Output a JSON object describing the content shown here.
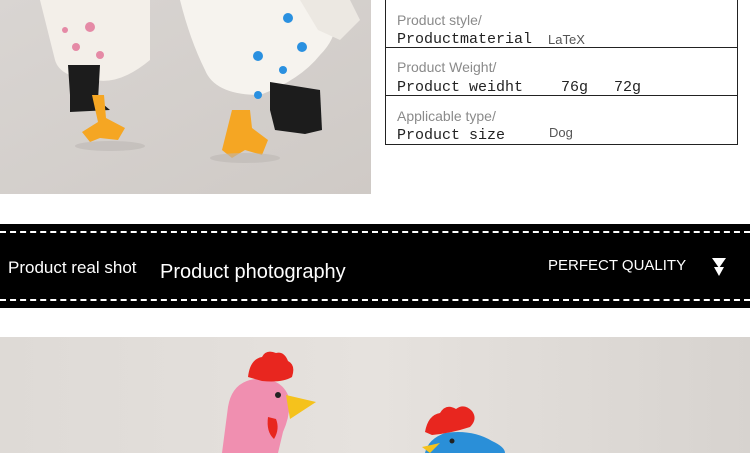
{
  "spec_table": {
    "rows": [
      {
        "label_en": "Product style/",
        "label_cn": "Productmaterial",
        "value": "LaTeX"
      },
      {
        "label_en": "Product Weight/",
        "label_cn": "Product weidht",
        "value_a": "76g",
        "value_b": "72g"
      },
      {
        "label_en": "Applicable type/",
        "label_cn": "Product size",
        "value": "Dog"
      }
    ]
  },
  "banner": {
    "left_text": "Product real shot",
    "middle_text": "Product photography",
    "right_text": "PERFECT QUALITY"
  },
  "colors": {
    "banner_bg": "#000000",
    "banner_text": "#ffffff",
    "table_border": "#222222"
  },
  "icons": {
    "banner_arrow": "down-arrow-icon"
  }
}
